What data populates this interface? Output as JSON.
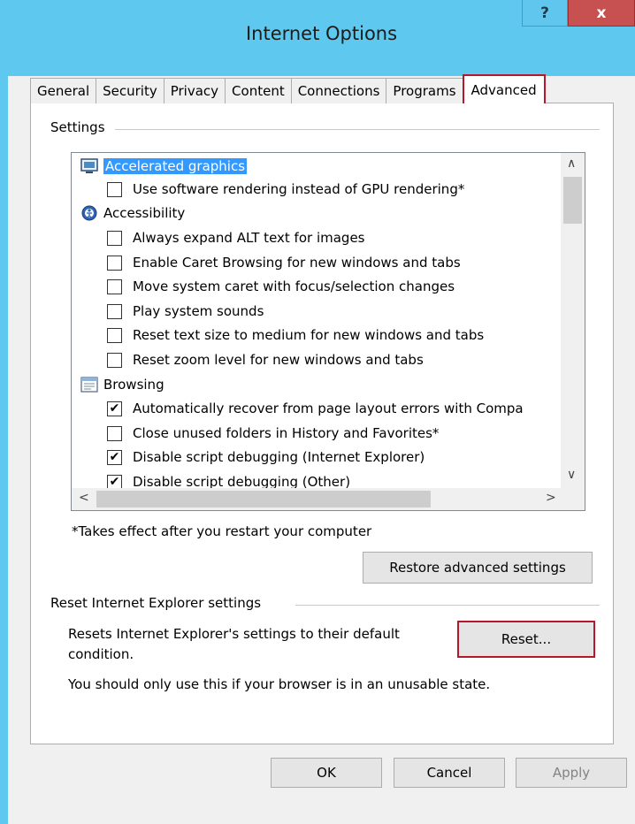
{
  "window": {
    "title": "Internet Options",
    "help_label": "?",
    "close_label": "x"
  },
  "tabs": [
    "General",
    "Security",
    "Privacy",
    "Content",
    "Connections",
    "Programs",
    "Advanced"
  ],
  "settings": {
    "group_label": "Settings",
    "items": [
      {
        "type": "category",
        "label": "Accelerated graphics",
        "icon": "monitor-icon",
        "selected": true
      },
      {
        "type": "check",
        "label": "Use software rendering instead of GPU rendering*",
        "checked": false
      },
      {
        "type": "category",
        "label": "Accessibility",
        "icon": "accessibility-icon"
      },
      {
        "type": "check",
        "label": "Always expand ALT text for images",
        "checked": false
      },
      {
        "type": "check",
        "label": "Enable Caret Browsing for new windows and tabs",
        "checked": false
      },
      {
        "type": "check",
        "label": "Move system caret with focus/selection changes",
        "checked": false
      },
      {
        "type": "check",
        "label": "Play system sounds",
        "checked": false
      },
      {
        "type": "check",
        "label": "Reset text size to medium for new windows and tabs",
        "checked": false
      },
      {
        "type": "check",
        "label": "Reset zoom level for new windows and tabs",
        "checked": false
      },
      {
        "type": "category",
        "label": "Browsing",
        "icon": "browsing-icon"
      },
      {
        "type": "check",
        "label": "Automatically recover from page layout errors with Compa",
        "checked": true
      },
      {
        "type": "check",
        "label": "Close unused folders in History and Favorites*",
        "checked": false
      },
      {
        "type": "check",
        "label": "Disable script debugging (Internet Explorer)",
        "checked": true
      },
      {
        "type": "check",
        "label": "Disable script debugging (Other)",
        "checked": true
      }
    ],
    "note": "*Takes effect after you restart your computer",
    "restore_button": "Restore advanced settings"
  },
  "reset": {
    "group_label": "Reset Internet Explorer settings",
    "description_line1": "Resets Internet Explorer's settings to their default",
    "description_line2": "condition.",
    "button": "Reset...",
    "warning": "You should only use this if your browser is in an unusable state."
  },
  "footer": {
    "ok": "OK",
    "cancel": "Cancel",
    "apply": "Apply"
  },
  "colors": {
    "title_bar": "#5fc8ef",
    "close_button": "#c75050",
    "highlight": "#b3182b",
    "selection": "#3399ff"
  }
}
